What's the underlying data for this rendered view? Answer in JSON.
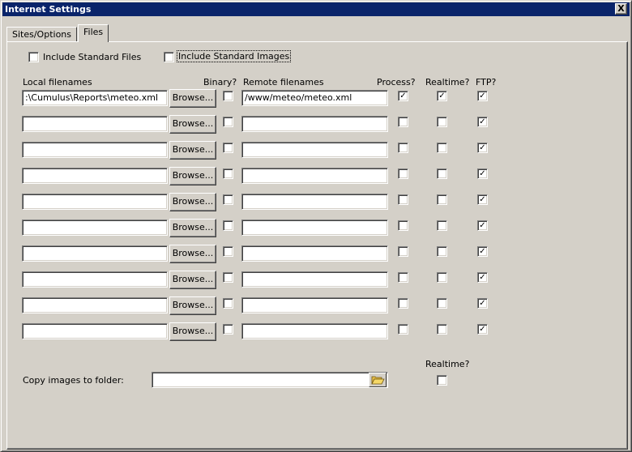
{
  "window": {
    "title": "Internet Settings",
    "close_glyph": "X"
  },
  "tabs": [
    {
      "label": "Sites/Options",
      "active": false
    },
    {
      "label": "Files",
      "active": true
    }
  ],
  "options": {
    "include_standard_files": {
      "label": "Include Standard Files",
      "checked": false
    },
    "include_standard_images": {
      "label": "Include Standard Images",
      "checked": false
    }
  },
  "headers": {
    "local": "Local filenames",
    "binary": "Binary?",
    "remote": "Remote filenames",
    "process": "Process?",
    "realtime": "Realtime?",
    "ftp": "FTP?"
  },
  "browse_label": "Browse...",
  "check_glyph": "✓",
  "rows": [
    {
      "local": ":\\Cumulus\\Reports\\meteo.xml",
      "binary": false,
      "remote": "/www/meteo/meteo.xml",
      "process": true,
      "realtime": true,
      "ftp": true
    },
    {
      "local": "",
      "binary": false,
      "remote": "",
      "process": false,
      "realtime": false,
      "ftp": true
    },
    {
      "local": "",
      "binary": false,
      "remote": "",
      "process": false,
      "realtime": false,
      "ftp": true
    },
    {
      "local": "",
      "binary": false,
      "remote": "",
      "process": false,
      "realtime": false,
      "ftp": true
    },
    {
      "local": "",
      "binary": false,
      "remote": "",
      "process": false,
      "realtime": false,
      "ftp": true
    },
    {
      "local": "",
      "binary": false,
      "remote": "",
      "process": false,
      "realtime": false,
      "ftp": true
    },
    {
      "local": "",
      "binary": false,
      "remote": "",
      "process": false,
      "realtime": false,
      "ftp": true
    },
    {
      "local": "",
      "binary": false,
      "remote": "",
      "process": false,
      "realtime": false,
      "ftp": true
    },
    {
      "local": "",
      "binary": false,
      "remote": "",
      "process": false,
      "realtime": false,
      "ftp": true
    },
    {
      "local": "",
      "binary": false,
      "remote": "",
      "process": false,
      "realtime": false,
      "ftp": true
    }
  ],
  "copy_images": {
    "label": "Copy images to folder:",
    "value": "",
    "realtime_label": "Realtime?",
    "realtime_checked": false,
    "folder_icon": "folder-open-icon"
  }
}
